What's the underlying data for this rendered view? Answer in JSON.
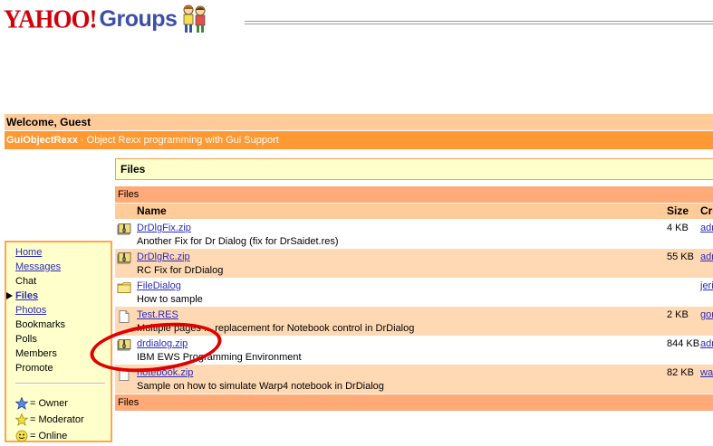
{
  "header": {
    "brand_yahoo": "YAHOO!",
    "brand_groups": "Groups"
  },
  "welcome": {
    "text": "Welcome, Guest"
  },
  "group": {
    "name": "GuiObjectRexx",
    "separator": "·",
    "description": "Object Rexx programming with Gui Support"
  },
  "sidebar": {
    "items": [
      {
        "label": "Home",
        "link": true,
        "current": false
      },
      {
        "label": "Messages",
        "link": true,
        "current": false
      },
      {
        "label": "Chat",
        "link": false,
        "current": false
      },
      {
        "label": "Files",
        "link": true,
        "current": true
      },
      {
        "label": "Photos",
        "link": true,
        "current": false
      },
      {
        "label": "Bookmarks",
        "link": false,
        "current": false
      },
      {
        "label": "Polls",
        "link": false,
        "current": false
      },
      {
        "label": "Members",
        "link": false,
        "current": false
      },
      {
        "label": "Promote",
        "link": false,
        "current": false
      }
    ],
    "legend": [
      {
        "icon": "blue-star-icon",
        "label": "= Owner"
      },
      {
        "icon": "yellow-star-icon",
        "label": "= Moderator"
      },
      {
        "icon": "smiley-icon",
        "label": "= Online"
      }
    ]
  },
  "main": {
    "title": "Files",
    "header_bar": "Files",
    "footer_bar": "Files",
    "columns": {
      "name": "Name",
      "size": "Size",
      "creator": "Cre"
    },
    "files": [
      {
        "icon": "zip-file-icon",
        "name": "DrDlgFix.zip",
        "description": "Another Fix for Dr Dialog (fix for DrSaidet.res)",
        "size": "4 KB",
        "creator": "adr"
      },
      {
        "icon": "zip-file-icon",
        "name": "DrDlgRc.zip",
        "description": "RC Fix for DrDialog",
        "size": "55 KB",
        "creator": "adr"
      },
      {
        "icon": "folder-icon",
        "name": "FileDialog",
        "description": "How to sample",
        "size": "",
        "creator": "jeri"
      },
      {
        "icon": "document-icon",
        "name": "Test.RES",
        "description": "Multiple pages ... replacement for Notebook control in DrDialog",
        "size": "2 KB",
        "creator": "gor"
      },
      {
        "icon": "zip-file-icon",
        "name": "drdialog.zip",
        "description": "IBM EWS Programming Environment",
        "size": "844 KB",
        "creator": "adr"
      },
      {
        "icon": "document-icon",
        "name": "notebook.zip",
        "description": "Sample on how to simulate Warp4 notebook in DrDialog",
        "size": "82 KB",
        "creator": "wa"
      }
    ]
  },
  "colors": {
    "welcome_bg": "#ffcc99",
    "group_bar_bg": "#ff9933",
    "sidebar_bg": "#ffffcc",
    "link": "#2b2bbf",
    "annotation": "#e00000"
  }
}
